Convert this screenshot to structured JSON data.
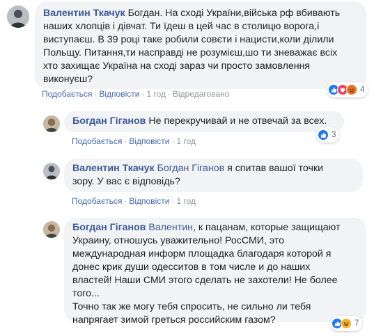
{
  "comments": [
    {
      "author": "Валентин Ткачук",
      "text_lines": [
        "Богдан. На сході України,війська рф вбивають",
        "наших хлопців і дівчат. Ти їдеш в цей час в столицю ворога,і",
        "виступаєш. В 39 році таке робили совєти і нацисти,коли ділили",
        "Польщу. Питання,ти насправді не розумієш,шо ти зневажає всіх",
        "хто захищає Україна на сході зараз чи просто замовлення",
        "виконуєш?"
      ],
      "like": "Подобається",
      "reply": "Відповісти",
      "time": "1 год",
      "edited": "Відредаговано",
      "reaction_count": "4",
      "reactions": [
        "like",
        "love",
        "angry"
      ]
    },
    {
      "author": "Богдан Гіганов",
      "text_lines": [
        "Не перекручивай и не отвечай за всех."
      ],
      "like": "Подобається",
      "reply": "Відповісти",
      "time": "1 год",
      "reaction_count": "3",
      "reactions": [
        "like"
      ]
    },
    {
      "author": "Валентин Ткачук",
      "mention": "Богдан Гіганов",
      "text_first": "я спитав вашої точки",
      "text_lines": [
        "зору. У вас є відповідь?"
      ],
      "like": "Подобається",
      "reply": "Відповісти",
      "time": "1 год"
    },
    {
      "author": "Богдан Гіганов",
      "mention": "Валентин",
      "text_first": ", к пацанам, которые защищают",
      "text_lines": [
        "Украину, отношусь уважительно! РосСМИ, это",
        "международная информ площадка благодаря которой я",
        "донес крик души одесситов в том числе и до наших",
        "властей! Наши СМИ этого сделать не захотели! Не более",
        "того...",
        "Точно так же могу тебя спросить, не сильно ли тебя",
        "напрягает зимой греться российским газом?"
      ],
      "like": "Подобається",
      "reply": "Відповісти",
      "time": "1 год",
      "reaction_count": "7",
      "reactions": [
        "like",
        "haha"
      ]
    }
  ],
  "colors": {
    "link": "#385898",
    "action": "#4267b2",
    "meta": "#90949c",
    "bubble": "#f2f3f5",
    "like": "#1877f2",
    "love": "#f33e58",
    "angry": "#e9710f",
    "haha": "#f7b125"
  }
}
